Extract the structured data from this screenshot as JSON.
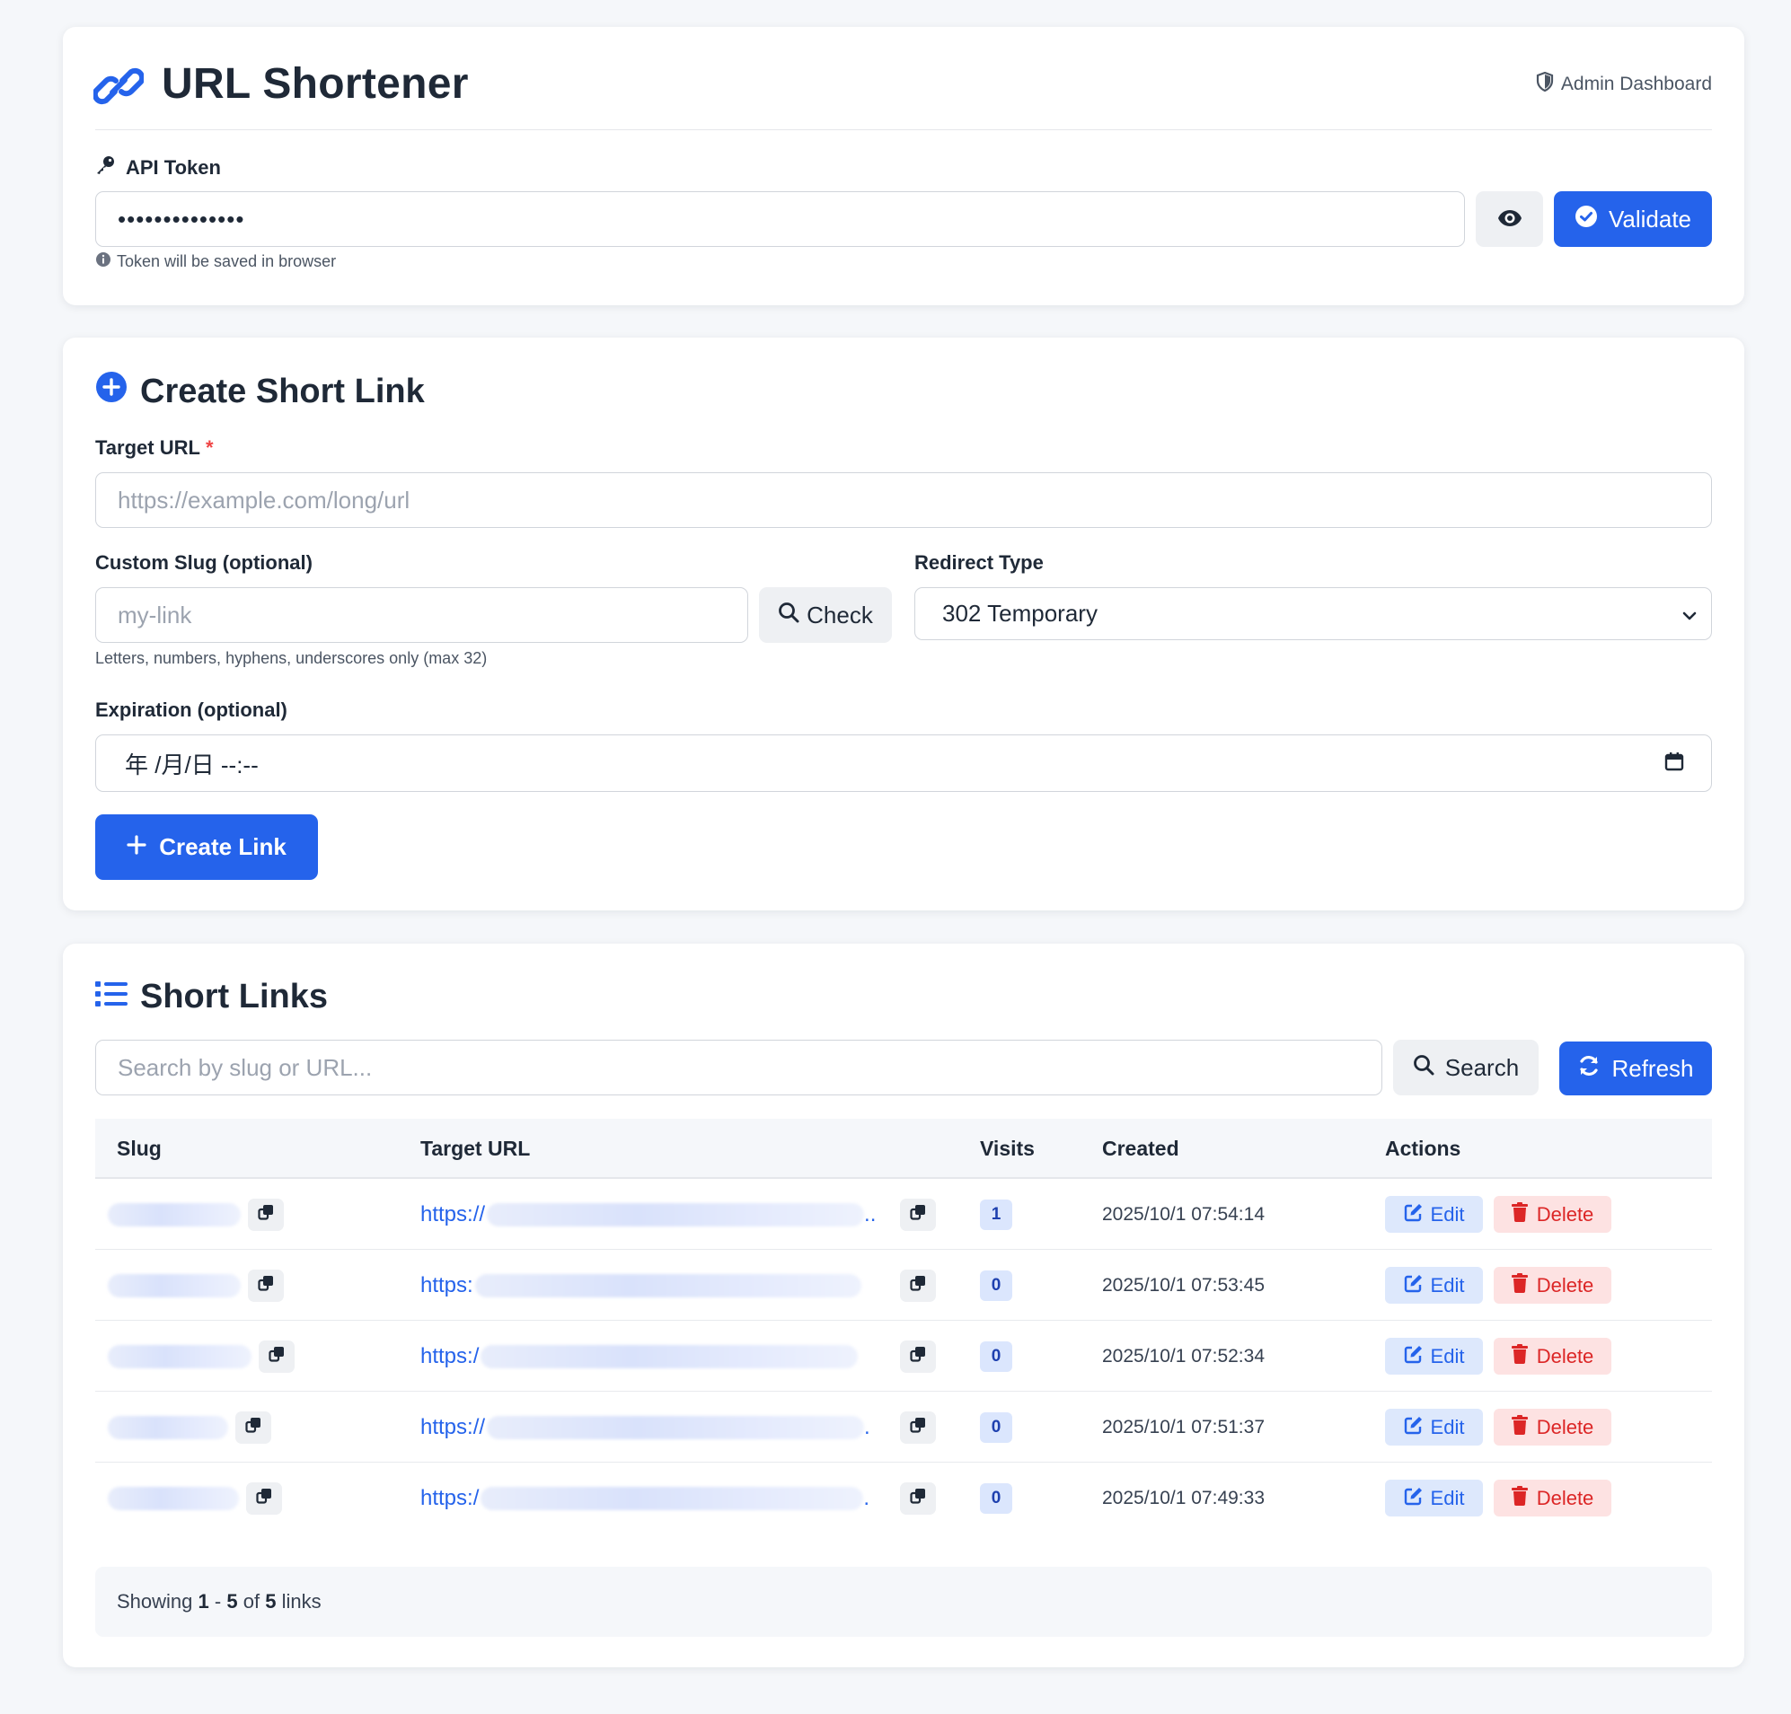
{
  "header": {
    "title": "URL Shortener",
    "admin_link": "Admin Dashboard"
  },
  "token": {
    "label": "API Token",
    "value": "••••••••••••••",
    "help": "Token will be saved in browser",
    "validate_label": "Validate"
  },
  "create": {
    "title": "Create Short Link",
    "target_label": "Target URL",
    "target_required": "*",
    "target_placeholder": "https://example.com/long/url",
    "slug_label": "Custom Slug (optional)",
    "slug_placeholder": "my-link",
    "check_label": "Check",
    "slug_help": "Letters, numbers, hyphens, underscores only (max 32)",
    "redirect_label": "Redirect Type",
    "redirect_selected": "302 Temporary",
    "expiration_label": "Expiration (optional)",
    "expiration_value": "年 /月/日 --:--",
    "create_label": "Create Link"
  },
  "links": {
    "title": "Short Links",
    "search_placeholder": "Search by slug or URL...",
    "search_label": "Search",
    "refresh_label": "Refresh",
    "columns": [
      "Slug",
      "Target URL",
      "Visits",
      "Created",
      "Actions"
    ],
    "rows": [
      {
        "url_prefix": "https://",
        "url_suffix": "..",
        "visits": "1",
        "created": "2025/10/1 07:54:14"
      },
      {
        "url_prefix": "https:",
        "url_suffix": "",
        "visits": "0",
        "created": "2025/10/1 07:53:45"
      },
      {
        "url_prefix": "https:/",
        "url_suffix": "",
        "visits": "0",
        "created": "2025/10/1 07:52:34"
      },
      {
        "url_prefix": "https://",
        "url_suffix": ".",
        "visits": "0",
        "created": "2025/10/1 07:51:37"
      },
      {
        "url_prefix": "https:/",
        "url_suffix": ".",
        "visits": "0",
        "created": "2025/10/1 07:49:33"
      }
    ],
    "edit_label": "Edit",
    "delete_label": "Delete",
    "footer": {
      "prefix": "Showing",
      "from": "1",
      "sep": "-",
      "to": "5",
      "of": "of",
      "total": "5",
      "suffix": "links"
    }
  },
  "colors": {
    "primary": "#2563eb",
    "danger": "#dc2626",
    "background": "#f5f7fa"
  },
  "icons": {
    "logo": "link-icon",
    "admin": "shield-icon",
    "token": "key-icon",
    "toggle": "eye-icon",
    "validate": "check-circle-icon",
    "create_title": "plus-circle-icon",
    "check": "search-icon",
    "select": "chevron-down-icon",
    "date": "calendar-icon",
    "create_btn": "plus-icon",
    "list_title": "list-icon",
    "search": "search-icon",
    "refresh": "refresh-icon",
    "copy": "copy-icon",
    "edit": "edit-icon",
    "delete": "trash-icon"
  }
}
